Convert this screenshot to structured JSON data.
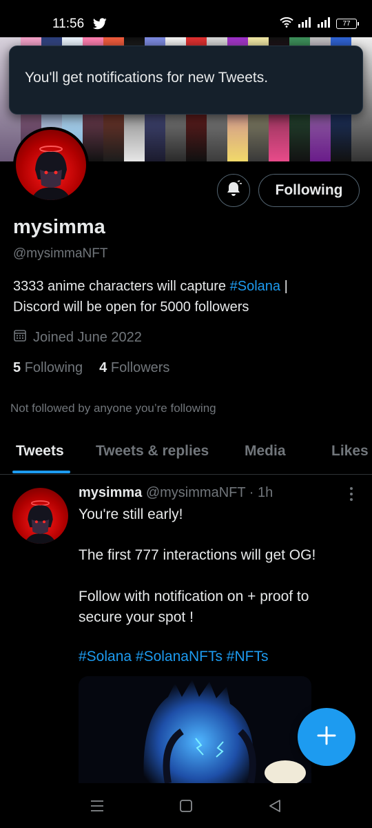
{
  "status_bar": {
    "time": "11:56",
    "battery": "77"
  },
  "toast": {
    "message": "You'll get notifications for new Tweets."
  },
  "profile": {
    "display_name": "mysimma",
    "handle": "@mysimmaNFT",
    "bio_part1": "3333 anime characters will capture ",
    "bio_link": "#Solana",
    "bio_part2": " |",
    "bio_line2": "Discord will be open for 5000 followers",
    "joined": "Joined June 2022",
    "following_count": "5",
    "following_label": "Following",
    "followers_count": "4",
    "followers_label": "Followers",
    "not_followed_text": "Not followed by anyone you’re following",
    "follow_button_label": "Following"
  },
  "tabs": [
    {
      "label": "Tweets",
      "active": true
    },
    {
      "label": "Tweets & replies",
      "active": false
    },
    {
      "label": "Media",
      "active": false
    },
    {
      "label": "Likes",
      "active": false
    }
  ],
  "tweet": {
    "name": "mysimma",
    "handle": "@mysimmaNFT",
    "separator": "·",
    "time": "1h",
    "line1": "You're still early!",
    "line2": "The first 777 interactions will get OG!",
    "line3a": "Follow with notification on + proof to",
    "line3b": "secure your spot !",
    "hashtags": "#Solana #SolanaNFTs #NFTs"
  },
  "colors": {
    "accent": "#1d9bf0",
    "background": "#000000",
    "secondary_text": "#71767b",
    "toast_bg": "#15202b"
  }
}
